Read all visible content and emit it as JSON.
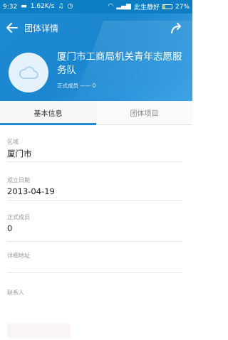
{
  "statusbar": {
    "time": "9:32",
    "speed": "1.62K/s",
    "carrier": "此生静好",
    "battery": "27%"
  },
  "nav": {
    "title": "团体详情"
  },
  "team": {
    "name": "厦门市工商局机关青年志愿服务队",
    "members_label": "正式成员 —— 0"
  },
  "tabs": [
    {
      "label": "基本信息",
      "active": true
    },
    {
      "label": "团体项目",
      "active": false
    }
  ],
  "fields": [
    {
      "label": "区域",
      "value": "厦门市"
    },
    {
      "label": "成立日期",
      "value": "2013-04-19"
    },
    {
      "label": "正式成员",
      "value": "0"
    },
    {
      "label": "详细地址",
      "value": ""
    },
    {
      "label": "联系人",
      "value": ""
    }
  ],
  "colors": {
    "primary": "#1d8ad3",
    "statusbar": "#0d7ec4"
  }
}
